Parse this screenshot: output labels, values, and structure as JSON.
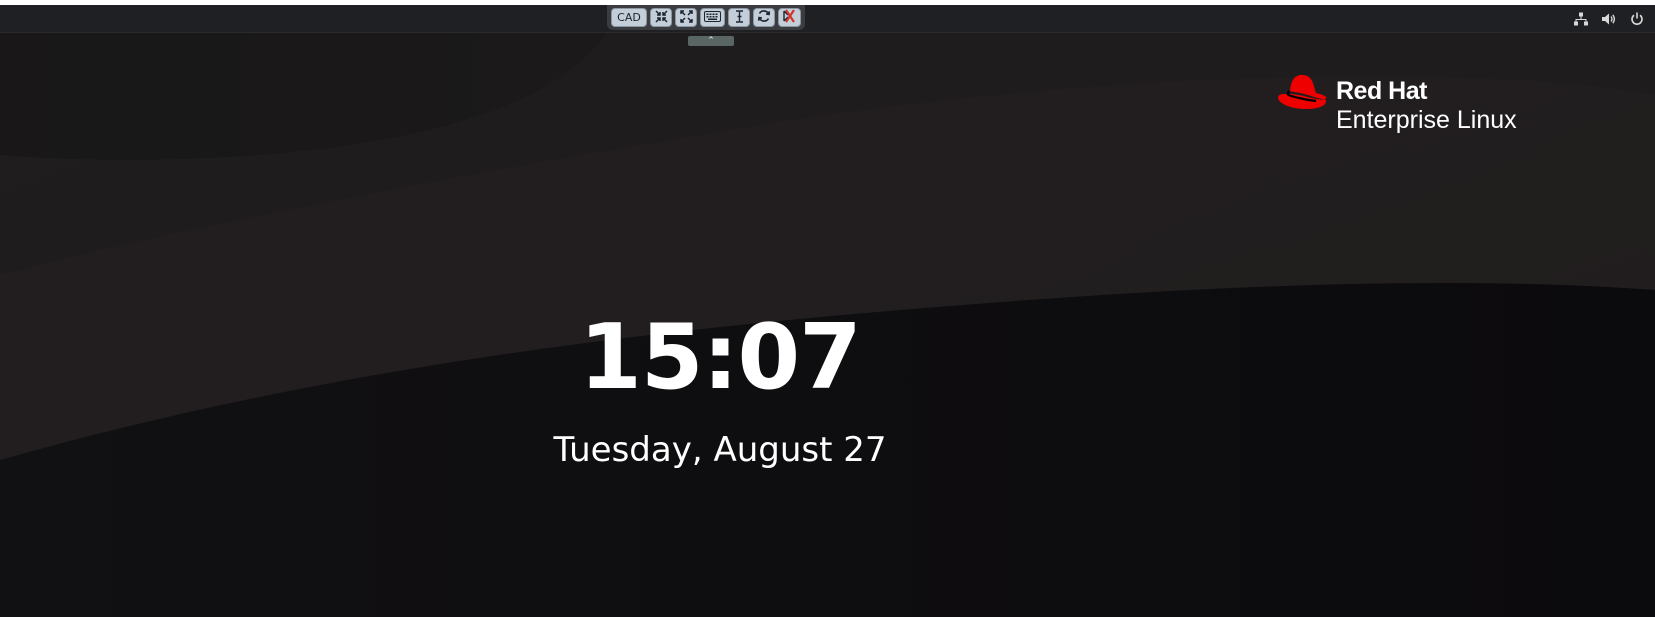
{
  "vnc_toolbar": {
    "buttons": [
      {
        "label": "CAD",
        "icon": null
      },
      {
        "label": "",
        "icon": "shrink-icon"
      },
      {
        "label": "",
        "icon": "fullscreen-icon"
      },
      {
        "label": "",
        "icon": "keyboard-icon"
      },
      {
        "label": "",
        "icon": "text-cursor-icon"
      },
      {
        "label": "",
        "icon": "refresh-icon"
      },
      {
        "label": "",
        "icon": "disconnect-icon"
      }
    ],
    "handle_icon": "⌃"
  },
  "tray": {
    "icons": [
      "network-icon",
      "volume-icon",
      "power-icon"
    ]
  },
  "brand": {
    "line1": "Red Hat",
    "line2": "Enterprise Linux",
    "accent_color": "#ee0000"
  },
  "lock_screen": {
    "time": "15:07",
    "date": "Tuesday, August 27"
  }
}
